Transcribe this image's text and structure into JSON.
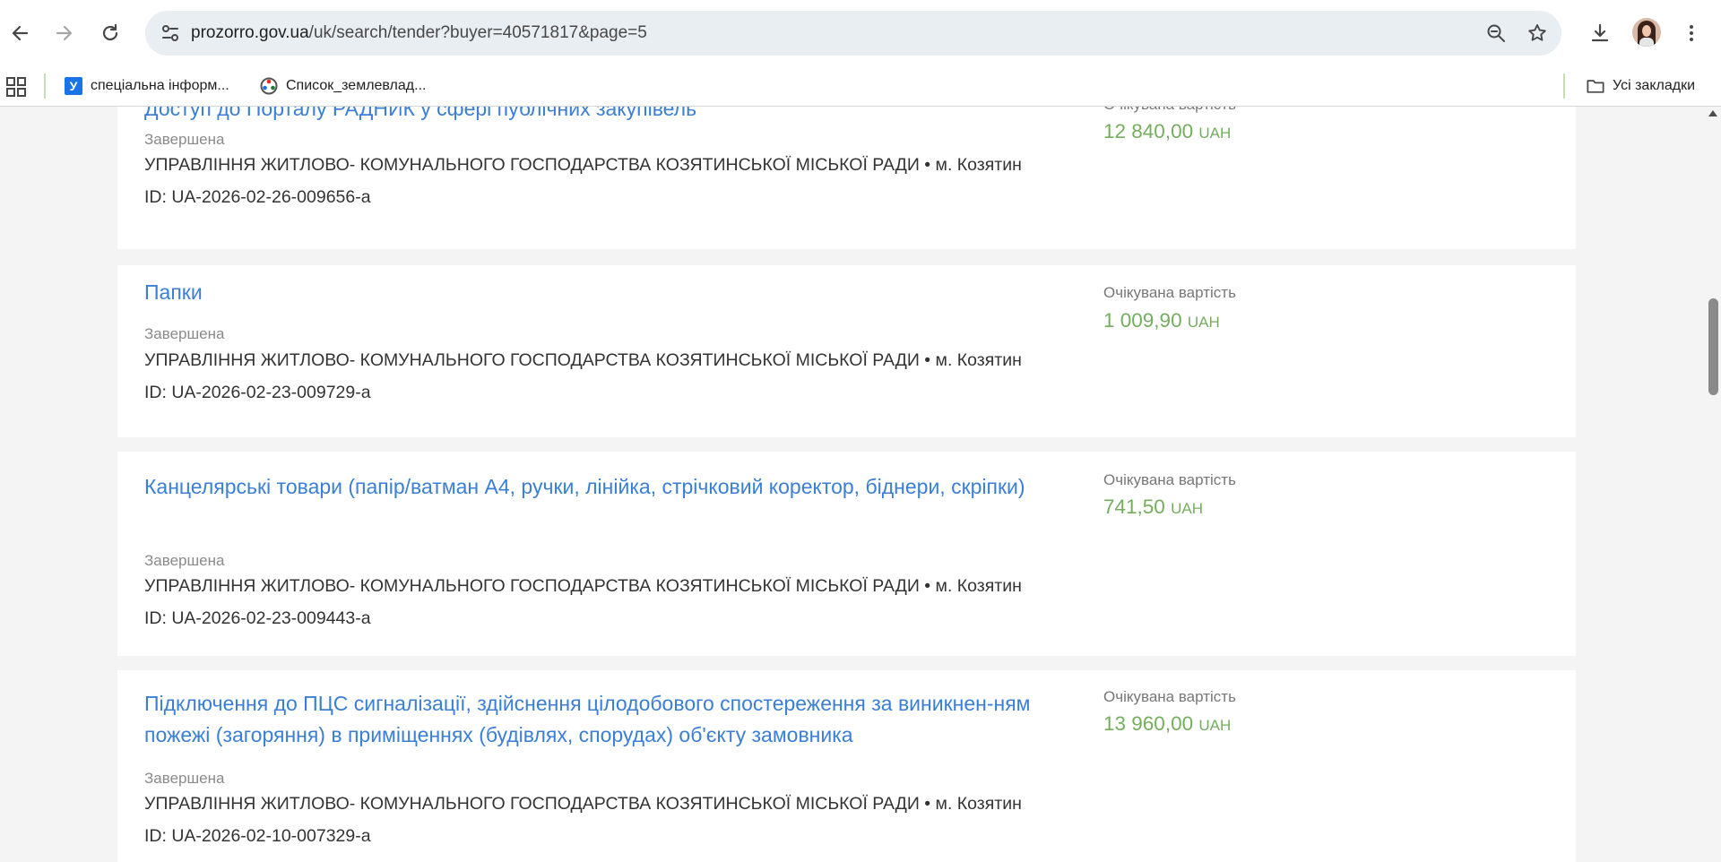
{
  "browser": {
    "url_host": "prozorro.gov.ua",
    "url_path": "/uk/search/tender?buyer=40571817&page=5",
    "bookmarks": [
      {
        "label": "спеціальна інформ...",
        "icon": "bookmark-favicon-u"
      },
      {
        "label": "Список_землевлад...",
        "icon": "wikipedia-favicon"
      }
    ],
    "all_bookmarks_label": "Усі закладки",
    "favicon_letter": "У"
  },
  "tenders": [
    {
      "title": "Доступ до Порталу РАДНИК у сфері публічних закупівель",
      "status": "Завершена",
      "buyer": "УПРАВЛІННЯ ЖИТЛОВО- КОМУНАЛЬНОГО ГОСПОДАРСТВА КОЗЯТИНСЬКОЇ МІСЬКОЇ РАДИ • м. Козятин",
      "id": "ID: UA-2026-02-26-009656-a",
      "price_label": "Очікувана вартість",
      "price": "12 840,00",
      "currency": "UAH"
    },
    {
      "title": "Папки",
      "status": "Завершена",
      "buyer": "УПРАВЛІННЯ ЖИТЛОВО- КОМУНАЛЬНОГО ГОСПОДАРСТВА КОЗЯТИНСЬКОЇ МІСЬКОЇ РАДИ • м. Козятин",
      "id": "ID: UA-2026-02-23-009729-a",
      "price_label": "Очікувана вартість",
      "price": "1 009,90",
      "currency": "UAH"
    },
    {
      "title": "Канцелярські товари (папір/ватман А4, ручки, лінійка, стрічковий коректор, біднери, скріпки)",
      "status": "Завершена",
      "buyer": "УПРАВЛІННЯ ЖИТЛОВО- КОМУНАЛЬНОГО ГОСПОДАРСТВА КОЗЯТИНСЬКОЇ МІСЬКОЇ РАДИ • м. Козятин",
      "id": "ID: UA-2026-02-23-009443-a",
      "price_label": "Очікувана вартість",
      "price": "741,50",
      "currency": "UAH"
    },
    {
      "title": "Підключення до ПЦС сигналізації, здійснення цілодобового спостереження за виникнен-ням пожежі (загоряння) в приміщеннях (будівлях, спорудах) об'єкту замовника",
      "status": "Завершена",
      "buyer": "УПРАВЛІННЯ ЖИТЛОВО- КОМУНАЛЬНОГО ГОСПОДАРСТВА КОЗЯТИНСЬКОЇ МІСЬКОЇ РАДИ • м. Козятин",
      "id": "ID: UA-2026-02-10-007329-a",
      "price_label": "Очікувана вартість",
      "price": "13 960,00",
      "currency": "UAH"
    }
  ]
}
